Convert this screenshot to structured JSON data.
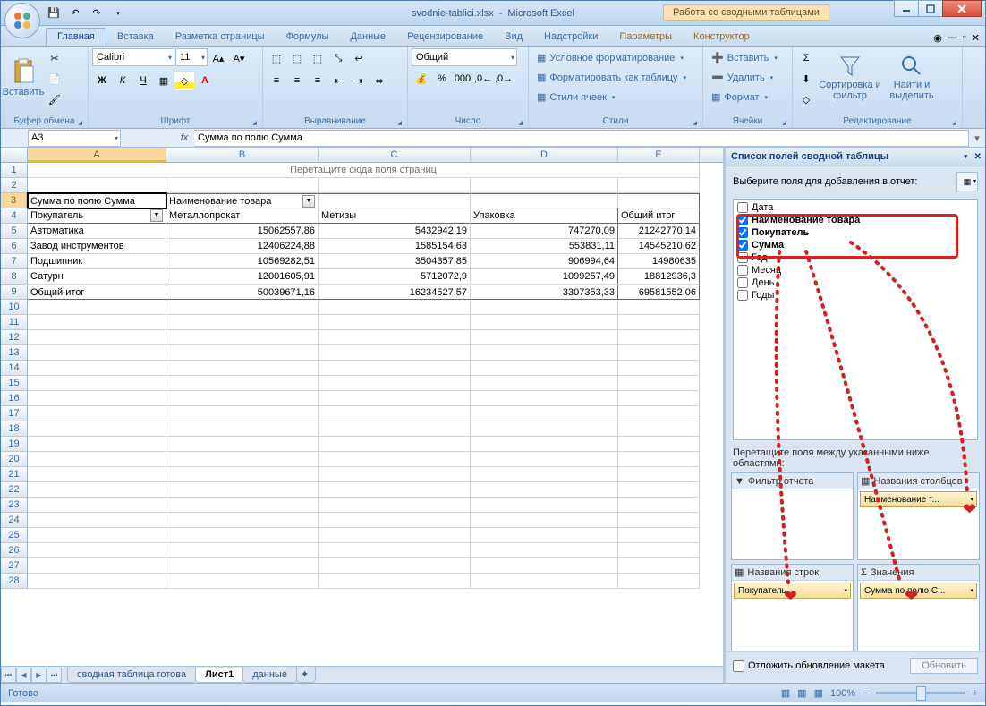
{
  "window": {
    "title_file": "svodnie-tablici.xlsx",
    "title_app": "Microsoft Excel",
    "context_title": "Работа со сводными таблицами"
  },
  "tabs": {
    "home": "Главная",
    "insert": "Вставка",
    "pagelayout": "Разметка страницы",
    "formulas": "Формулы",
    "data": "Данные",
    "review": "Рецензирование",
    "view": "Вид",
    "addins": "Надстройки",
    "options": "Параметры",
    "design": "Конструктор"
  },
  "ribbon": {
    "clipboard": {
      "paste": "Вставить",
      "title": "Буфер обмена"
    },
    "font": {
      "name": "Calibri",
      "size": "11",
      "title": "Шрифт"
    },
    "align": {
      "title": "Выравнивание"
    },
    "number": {
      "format": "Общий",
      "title": "Число"
    },
    "styles": {
      "cond": "Условное форматирование",
      "table": "Форматировать как таблицу",
      "cell": "Стили ячеек",
      "title": "Стили"
    },
    "cells": {
      "insert": "Вставить",
      "delete": "Удалить",
      "format": "Формат",
      "title": "Ячейки"
    },
    "editing": {
      "sort": "Сортировка и фильтр",
      "find": "Найти и выделить",
      "title": "Редактирование"
    }
  },
  "namebox": "A3",
  "formula": "Сумма по полю Сумма",
  "cols": [
    "A",
    "B",
    "C",
    "D",
    "E"
  ],
  "rowcount": 28,
  "pivot": {
    "pagehint": "Перетащите сюда поля страниц",
    "datafield": "Сумма по полю Сумма",
    "colfield_label": "Наименование товара",
    "rowfield_label": "Покупатель",
    "cols": [
      "Металлопрокат",
      "Метизы",
      "Упаковка",
      "Общий итог"
    ],
    "rows": [
      {
        "name": "Автоматика",
        "v": [
          "15062557,86",
          "5432942,19",
          "747270,09",
          "21242770,14"
        ]
      },
      {
        "name": "Завод инструментов",
        "v": [
          "12406224,88",
          "1585154,63",
          "553831,11",
          "14545210,62"
        ]
      },
      {
        "name": "Подшипник",
        "v": [
          "10569282,51",
          "3504357,85",
          "906994,64",
          "14980635"
        ]
      },
      {
        "name": "Сатурн",
        "v": [
          "12001605,91",
          "5712072,9",
          "1099257,49",
          "18812936,3"
        ]
      }
    ],
    "total": {
      "name": "Общий итог",
      "v": [
        "50039671,16",
        "16234527,57",
        "3307353,33",
        "69581552,06"
      ]
    }
  },
  "sheets": {
    "navs": [
      "⏮",
      "◀",
      "▶",
      "⏭"
    ],
    "t1": "сводная таблица готова",
    "t2": "Лист1",
    "t3": "данные"
  },
  "taskpane": {
    "title": "Список полей сводной таблицы",
    "choose": "Выберите поля для добавления в отчет:",
    "fields": [
      {
        "label": "Дата",
        "checked": false,
        "bold": false
      },
      {
        "label": "Наименование товара",
        "checked": true,
        "bold": true
      },
      {
        "label": "Покупатель",
        "checked": true,
        "bold": true
      },
      {
        "label": "Сумма",
        "checked": true,
        "bold": true
      },
      {
        "label": "Год",
        "checked": false,
        "bold": false
      },
      {
        "label": "Месяц",
        "checked": false,
        "bold": false
      },
      {
        "label": "День",
        "checked": false,
        "bold": false
      },
      {
        "label": "Годы",
        "checked": false,
        "bold": false
      }
    ],
    "draghint": "Перетащите поля между указанными ниже областями:",
    "areas": {
      "filter": "Фильтр отчета",
      "cols": "Названия столбцов",
      "rows": "Названия строк",
      "values": "Значения",
      "col_item": "Наименование т...",
      "row_item": "Покупатель",
      "val_item": "Сумма по полю С..."
    },
    "defer": "Отложить обновление макета",
    "update": "Обновить"
  },
  "status": {
    "ready": "Готово",
    "zoom": "100%"
  }
}
